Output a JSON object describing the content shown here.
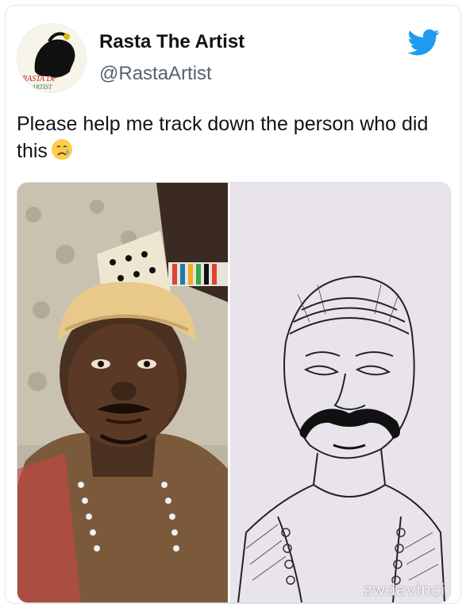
{
  "tweet": {
    "display_name": "Rasta The Artist",
    "handle": "@RastaArtist",
    "text": "Please help me track down the person who did this",
    "emoji": "crying-face-emoji",
    "platform_icon": "twitter-bird-icon",
    "brand_color": "#1d9bf0"
  },
  "avatar": {
    "logo_text_line1": "RASTA De",
    "logo_text_line2": "ARTIST"
  },
  "media": {
    "left_image": "photo-of-man-with-headwrap",
    "right_image": "pencil-sketch-of-man",
    "watermark": "zwdavinci"
  }
}
